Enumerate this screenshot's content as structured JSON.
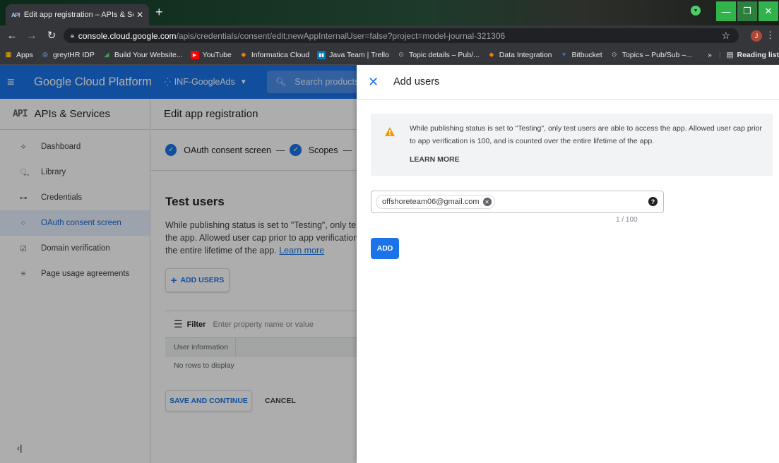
{
  "browser": {
    "tab_title": "Edit app registration – APIs & Se",
    "tab_favicon": "API",
    "url_host": "console.cloud.google.com",
    "url_path": "/apis/credentials/consent/edit;newAppInternalUser=false?project=model-journal-321306",
    "profile_initial": "J"
  },
  "bookmarks": {
    "items": [
      {
        "label": "Apps",
        "icon": "apps-grid-icon",
        "color": "#fbbc04"
      },
      {
        "label": "greytHR IDP",
        "icon": "greythr-icon",
        "color": "#8ab4f8"
      },
      {
        "label": "Build Your Website...",
        "icon": "website-builder-icon",
        "color": "#34a853"
      },
      {
        "label": "YouTube",
        "icon": "youtube-icon",
        "color": "#ff0000"
      },
      {
        "label": "Informatica Cloud",
        "icon": "informatica-icon",
        "color": "#f57c00"
      },
      {
        "label": "Java Team | Trello",
        "icon": "trello-icon",
        "color": "#0079bf"
      },
      {
        "label": "Topic details – Pub/...",
        "icon": "pubsub-icon",
        "color": "#bdc1c6"
      },
      {
        "label": "Data Integration",
        "icon": "informatica-icon",
        "color": "#f57c00"
      },
      {
        "label": "Bitbucket",
        "icon": "bitbucket-icon",
        "color": "#2684ff"
      },
      {
        "label": "Topics – Pub/Sub –...",
        "icon": "pubsub-icon",
        "color": "#bdc1c6"
      }
    ],
    "overflow": "»",
    "reading_list": "Reading list"
  },
  "header": {
    "brand": "Google Cloud Platform",
    "project": "INF-GoogleAds",
    "search_placeholder": "Search products",
    "accent": "#1a73e8"
  },
  "sidebar": {
    "title_icon": "API",
    "title": "APIs & Services",
    "items": [
      {
        "label": "Dashboard",
        "icon": "dashboard-icon",
        "glyph": "⟡"
      },
      {
        "label": "Library",
        "icon": "library-icon",
        "glyph": "⵿"
      },
      {
        "label": "Credentials",
        "icon": "key-icon",
        "glyph": "⊶"
      },
      {
        "label": "OAuth consent screen",
        "icon": "consent-icon",
        "glyph": "⁘"
      },
      {
        "label": "Domain verification",
        "icon": "domain-check-icon",
        "glyph": "☑"
      },
      {
        "label": "Page usage agreements",
        "icon": "settings-list-icon",
        "glyph": "≡"
      }
    ],
    "active_index": 3,
    "collapse_glyph": "‹|"
  },
  "main": {
    "title": "Edit app registration",
    "steps": [
      "OAuth consent screen",
      "Scopes"
    ],
    "section_title": "Test users",
    "desc_lines": [
      "While publishing status is set to \"Testing\", only test",
      "the app. Allowed user cap prior to app verification i",
      "the entire lifetime of the app. "
    ],
    "learn_more_link": "Learn more",
    "add_users": "ADD USERS",
    "filter_label": "Filter",
    "filter_placeholder": "Enter property name or value",
    "column_header": "User information",
    "empty_text": "No rows to display",
    "save_button": "SAVE AND CONTINUE",
    "cancel_button": "CANCEL"
  },
  "panel": {
    "title": "Add users",
    "notice": "While publishing status is set to \"Testing\", only test users are able to access the app. Allowed user cap prior to app verification is 100, and is counted over the entire lifetime of the app.",
    "notice_link": "LEARN MORE",
    "chip_email": "offshoreteam06@gmail.com",
    "counter": "1 / 100",
    "add_button": "ADD",
    "warning_color": "#f29900"
  }
}
